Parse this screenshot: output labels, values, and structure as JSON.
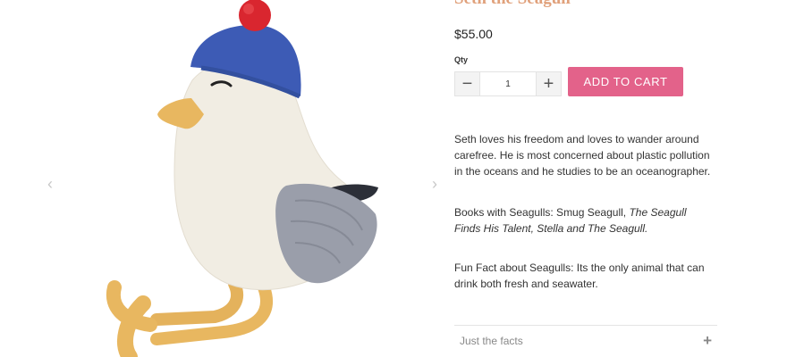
{
  "gallery": {
    "image_alt": "Seth the Seagull crochet toy",
    "prev_icon": "chevron-left-icon",
    "next_icon": "chevron-right-icon",
    "prev_glyph": "‹",
    "next_glyph": "›"
  },
  "product": {
    "title": "Seth the Seagull",
    "price": "$55.00",
    "qty_label": "Qty",
    "qty_value": "1",
    "minus_glyph": "−",
    "plus_glyph": "+",
    "add_to_cart": "ADD TO CART",
    "description": {
      "p1": "Seth loves his freedom and loves to wander around carefree. He is most concerned about plastic pollution in the oceans and he studies to be an oceanographer.",
      "p2_prefix": "Books with Seagulls: Smug Seagull, ",
      "p2_italic": "The Seagull Finds His Talent, Stella and The Seagull.",
      "p3": "Fun Fact about Seagulls: Its the only animal that can drink both fresh and seawater."
    },
    "accordion": {
      "label": "Just the facts",
      "toggle_glyph": "+"
    }
  },
  "colors": {
    "title": "#e0a07a",
    "button": "#e3628a",
    "hat_blue": "#3d5bb5",
    "pompom": "#d9262f",
    "body_cream": "#f1ede3",
    "beak_yellow": "#e8b760",
    "wing_grey": "#9a9eaa"
  }
}
